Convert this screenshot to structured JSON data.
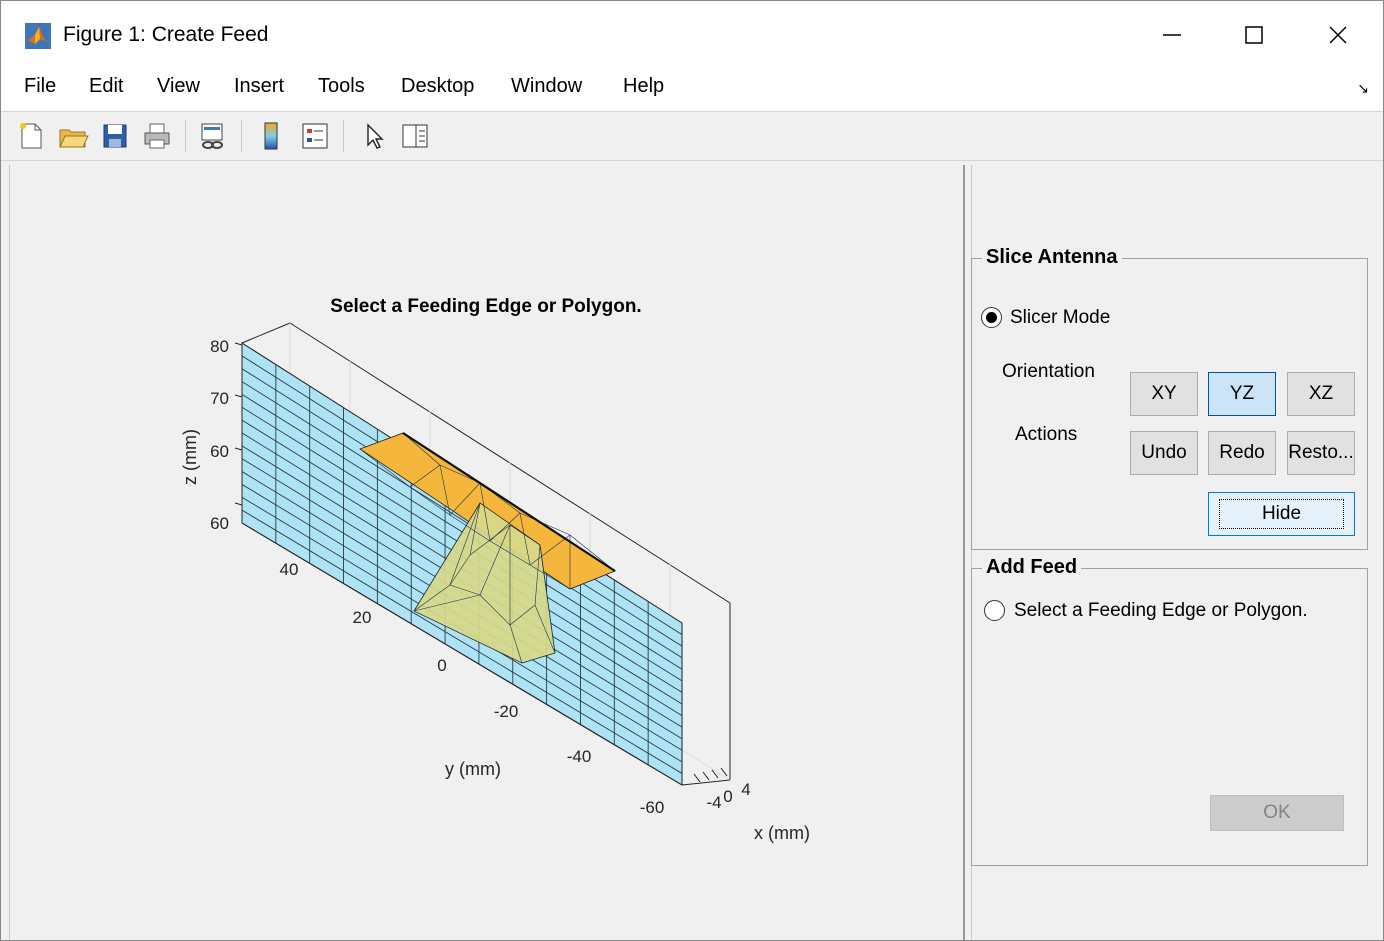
{
  "window": {
    "title": "Figure 1: Create Feed"
  },
  "menu": [
    "File",
    "Edit",
    "View",
    "Insert",
    "Tools",
    "Desktop",
    "Window",
    "Help"
  ],
  "plot": {
    "title": "Select a Feeding Edge or Polygon.",
    "zlabel": "z (mm)",
    "ylabel": "y (mm)",
    "xlabel": "x (mm)",
    "z_ticks": [
      "80",
      "70",
      "60",
      "60"
    ],
    "y_ticks": [
      "40",
      "20",
      "0",
      "-20",
      "-40",
      "-60"
    ],
    "x_ticks": [
      "-4",
      "0",
      "4"
    ]
  },
  "slice_panel": {
    "title": "Slice Antenna",
    "mode_label": "Slicer Mode",
    "orientation_label": "Orientation",
    "actions_label": "Actions",
    "xy": "XY",
    "yz": "YZ",
    "xz": "XZ",
    "undo": "Undo",
    "redo": "Redo",
    "restore": "Resto...",
    "hide": "Hide"
  },
  "feed_panel": {
    "title": "Add Feed",
    "option_label": "Select a Feeding Edge or Polygon.",
    "ok": "OK"
  },
  "colors": {
    "slice_plane": "#aee3f5",
    "patch": "#f5b63c",
    "feed": "#d8d98a"
  }
}
